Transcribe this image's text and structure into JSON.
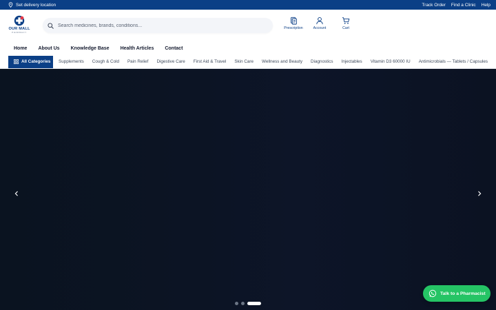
{
  "topbar": {
    "location_label": "Set delivery location",
    "links": [
      "Track Order",
      "Find a Clinic",
      "Help"
    ]
  },
  "brand": {
    "name": "OUR MALL",
    "tagline": "PHARMACY",
    "color": "#0b3f86"
  },
  "search": {
    "placeholder": "Search medicines, brands, conditions..."
  },
  "header_actions": [
    {
      "label": "Prescription",
      "icon": "prescription-icon"
    },
    {
      "label": "Account",
      "icon": "account-icon"
    },
    {
      "label": "Cart",
      "icon": "cart-icon"
    }
  ],
  "main_nav": [
    "Home",
    "About Us",
    "Knowledge Base",
    "Health Articles",
    "Contact"
  ],
  "category_bar": {
    "all_label": "All Categories",
    "items": [
      "Supplements",
      "Cough & Cold",
      "Pain Relief",
      "Digestive Care",
      "First Aid & Travel",
      "Skin Care",
      "Wellness and Beauty",
      "Diagnostics",
      "Injectables",
      "Vitamin D3 60000 IU",
      "Antimicrobials — Tablets / Capsules"
    ]
  },
  "hero": {
    "slides_count": 3,
    "active_slide": 3
  },
  "whatsapp": {
    "label": "Talk to a Pharmacist",
    "color": "#25c465"
  }
}
